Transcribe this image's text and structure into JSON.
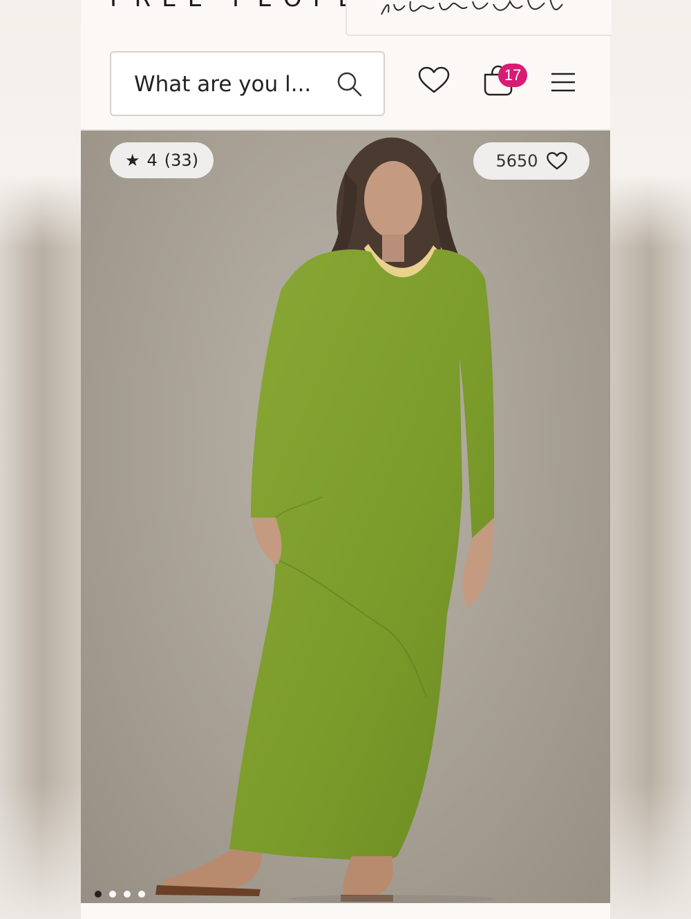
{
  "header": {
    "brand_name": "FREE PEOPLE",
    "secondary_brand": "free people movement",
    "search": {
      "placeholder": "What are you l..."
    },
    "cart": {
      "count": "17"
    }
  },
  "product_image": {
    "rating": {
      "stars": "4",
      "count": "(33)"
    },
    "favorites": "5650",
    "carousel": {
      "total": 4,
      "active_index": 0
    }
  },
  "colors": {
    "accent": "#d81b73",
    "dress": "#7d9a2c",
    "background": "#fbf8f6"
  }
}
